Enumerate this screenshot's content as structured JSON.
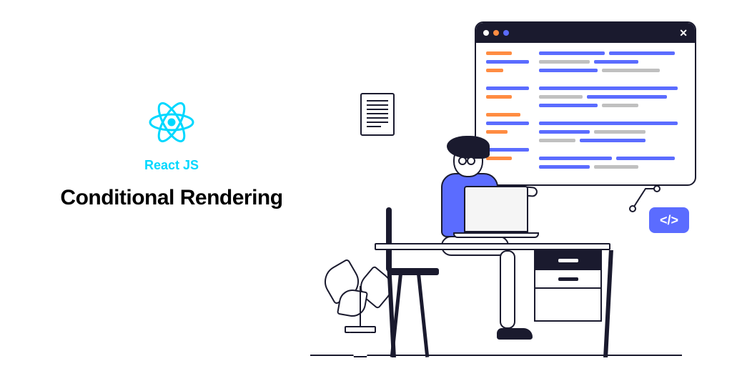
{
  "branding": {
    "tech_label": "React JS"
  },
  "title": "Conditional Rendering",
  "icons": {
    "code_tag": "</>",
    "window_close": "✕"
  },
  "colors": {
    "accent_cyan": "#00d8ff",
    "accent_blue": "#5b6cff",
    "accent_orange": "#ff8c42",
    "ink": "#1a1a2e"
  }
}
